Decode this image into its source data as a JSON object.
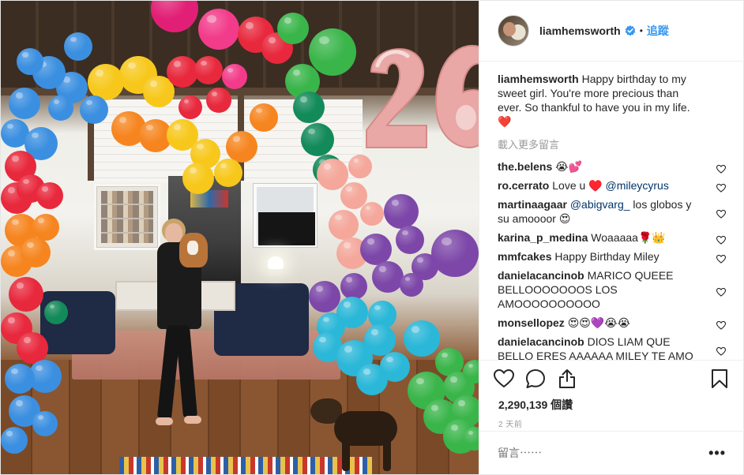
{
  "post": {
    "username": "liamhemsworth",
    "verified_icon": "verified-badge-icon",
    "separator": "•",
    "follow_label": "追蹤",
    "caption_user": "liamhemsworth",
    "caption_text": "Happy birthday to my sweet girl. You're more precious than ever. So thankful to have you in my life.",
    "caption_emoji": "❤️",
    "load_more": "載入更多留言"
  },
  "comments": [
    {
      "user": "the.belens",
      "text": "😭💕",
      "mention": ""
    },
    {
      "user": "ro.cerrato",
      "text": "Love u ♥️ ",
      "mention": "@mileycyrus"
    },
    {
      "user": "martinaagaar",
      "text": "",
      "mention": "@abigvarg_",
      "after": " los globos y su amoooor 😍"
    },
    {
      "user": "karina_p_medina",
      "text": "Woaaaaa🌹👑",
      "mention": ""
    },
    {
      "user": "mmfcakes",
      "text": "Happy Birthday Miley",
      "mention": ""
    },
    {
      "user": "danielacancinob",
      "text": "MARICO QUEEE BELLOOOOOOOS LOS AMOOOOOOOOOO",
      "mention": ""
    },
    {
      "user": "monsellopez",
      "text": "😍😍💜😭😭",
      "mention": ""
    },
    {
      "user": "danielacancinob",
      "text": "DIOS LIAM QUE BELLO ERES AAAAAA MILEY TE AMO",
      "mention": ""
    }
  ],
  "actions": {
    "like_icon": "heart-icon",
    "comment_icon": "comment-bubble-icon",
    "share_icon": "share-icon",
    "save_icon": "bookmark-icon"
  },
  "stats": {
    "views": "2,290,139 個讚",
    "time": "2 天前"
  },
  "add_comment": {
    "placeholder": "留言⋯⋯",
    "more_label": "•••"
  },
  "photo": {
    "balloon_number": "26"
  },
  "colors": {
    "accent": "#3897f0",
    "mention": "#003569",
    "muted": "#999999"
  }
}
